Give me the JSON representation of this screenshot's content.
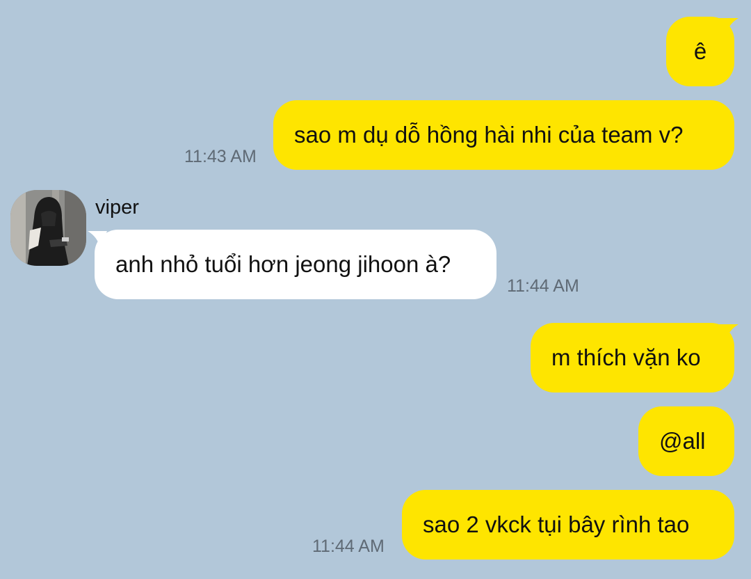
{
  "colors": {
    "background": "#b2c7d9",
    "my_bubble": "#fee500",
    "other_bubble": "#ffffff"
  },
  "messages": [
    {
      "from": "me",
      "text": "ê"
    },
    {
      "from": "me",
      "text": "sao m dụ dỗ hồng hài nhi của team v?",
      "time": "11:43 AM"
    },
    {
      "from": "viper",
      "sender": "viper",
      "text": "anh nhỏ tuổi hơn jeong jihoon à?",
      "time": "11:44 AM",
      "avatar_icon": "avatar-photo"
    },
    {
      "from": "me",
      "text": "m thích vặn ko"
    },
    {
      "from": "me",
      "text": "@all"
    },
    {
      "from": "me",
      "text": "sao 2 vkck tụi bây rình tao",
      "time": "11:44 AM"
    }
  ]
}
